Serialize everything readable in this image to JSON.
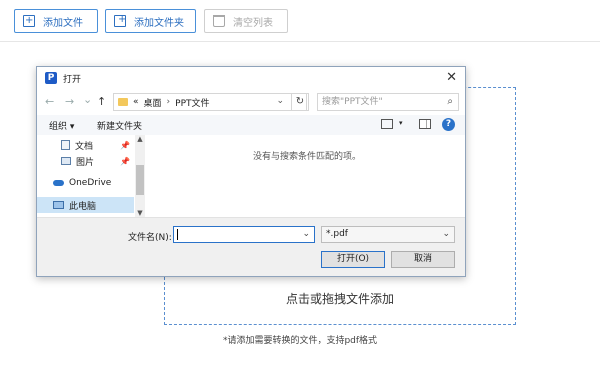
{
  "toolbar": {
    "add_file": "添加文件",
    "add_folder": "添加文件夹",
    "clear_list": "清空列表"
  },
  "dropzone": {
    "text": "点击或拖拽文件添加",
    "hint": "*请添加需要转换的文件，支持pdf格式"
  },
  "dialog": {
    "title": "打开",
    "close": "✕",
    "nav": {
      "back": "←",
      "forward": "→",
      "recent": "⌄",
      "up": "↑"
    },
    "address": {
      "prefix": "«",
      "path1": "桌面",
      "sep": "›",
      "path2": "PPT文件",
      "dropdown": "⌄"
    },
    "refresh": "↻",
    "search_placeholder": "搜索\"PPT文件\"",
    "search_icon": "⌕",
    "commands": {
      "organize": "组织 ▾",
      "new_folder": "新建文件夹",
      "help": "?"
    },
    "nav_items": [
      {
        "label": "文档",
        "icon": "document-icon",
        "pinned": true
      },
      {
        "label": "图片",
        "icon": "picture-icon",
        "pinned": true
      },
      {
        "label": "OneDrive",
        "icon": "cloud-icon",
        "pinned": false
      },
      {
        "label": "此电脑",
        "icon": "computer-icon",
        "pinned": false,
        "selected": true
      }
    ],
    "empty_message": "没有与搜索条件匹配的项。",
    "filename_label": "文件名(N):",
    "filename_value": "",
    "file_type": "*.pdf",
    "open_button": "打开(O)",
    "cancel_button": "取消"
  },
  "colors": {
    "accent": "#2a72c9",
    "dropzone_border": "#5a8fd0"
  }
}
